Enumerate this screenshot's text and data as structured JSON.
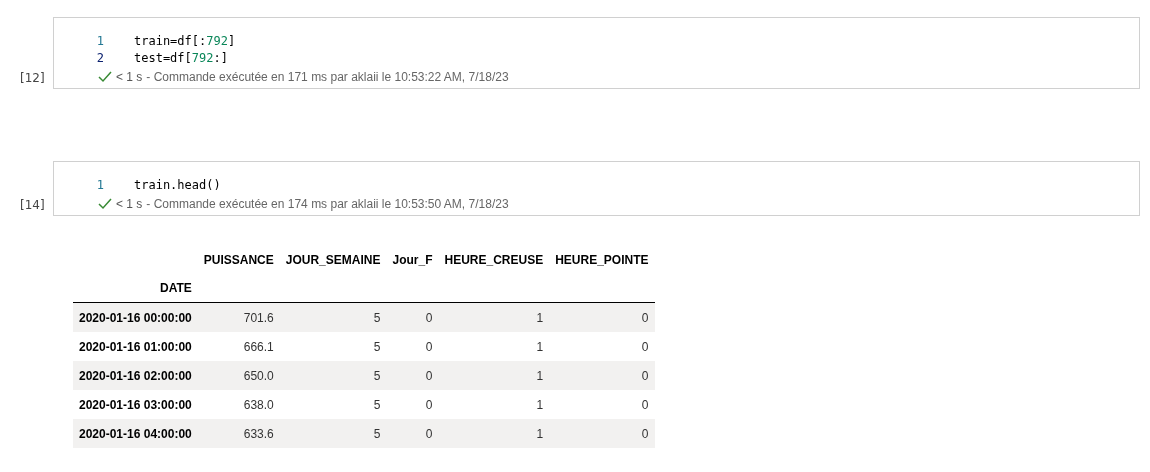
{
  "cells": [
    {
      "execution_count": "[12]",
      "lines": [
        {
          "number": "1",
          "tokens": [
            {
              "kind": "plain",
              "text": "train=df[:"
            },
            {
              "kind": "number",
              "text": "792"
            },
            {
              "kind": "plain",
              "text": "]"
            }
          ]
        },
        {
          "number": "2",
          "tokens": [
            {
              "kind": "plain",
              "text": "test=df["
            },
            {
              "kind": "number",
              "text": "792"
            },
            {
              "kind": "plain",
              "text": ":]"
            }
          ]
        }
      ],
      "status": {
        "succeeded": true,
        "duration": "< 1 s",
        "message": "- Commande exécutée en 171 ms par aklaii le 10:53:22 AM, 7/18/23"
      }
    },
    {
      "execution_count": "[14]",
      "lines": [
        {
          "number": "1",
          "tokens": [
            {
              "kind": "plain",
              "text": "train.head()"
            }
          ]
        }
      ],
      "status": {
        "succeeded": true,
        "duration": "< 1 s",
        "message": "- Commande exécutée en 174 ms par aklaii le 10:53:50 AM, 7/18/23"
      },
      "output": {
        "columns": [
          "PUISSANCE",
          "JOUR_SEMAINE",
          "Jour_F",
          "HEURE_CREUSE",
          "HEURE_POINTE"
        ],
        "index_name": "DATE",
        "rows": [
          {
            "index": "2020-01-16 00:00:00",
            "values": [
              "701.6",
              "5",
              "0",
              "1",
              "0"
            ]
          },
          {
            "index": "2020-01-16 01:00:00",
            "values": [
              "666.1",
              "5",
              "0",
              "1",
              "0"
            ]
          },
          {
            "index": "2020-01-16 02:00:00",
            "values": [
              "650.0",
              "5",
              "0",
              "1",
              "0"
            ]
          },
          {
            "index": "2020-01-16 03:00:00",
            "values": [
              "638.0",
              "5",
              "0",
              "1",
              "0"
            ]
          },
          {
            "index": "2020-01-16 04:00:00",
            "values": [
              "633.6",
              "5",
              "0",
              "1",
              "0"
            ]
          }
        ]
      }
    }
  ]
}
